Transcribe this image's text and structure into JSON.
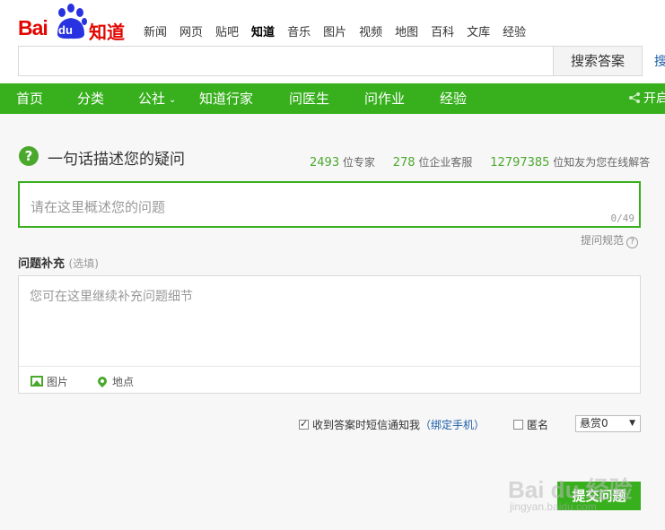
{
  "logo": {
    "bai": "Bai",
    "du": "du",
    "zhidao": "知道"
  },
  "topnav": [
    "新闻",
    "网页",
    "贴吧",
    "知道",
    "音乐",
    "图片",
    "视频",
    "地图",
    "百科",
    "文库",
    "经验"
  ],
  "topnav_active": "知道",
  "search": {
    "value": "",
    "button": "搜索答案",
    "extra": "搜"
  },
  "mainnav": {
    "items": [
      "首页",
      "分类",
      "公社",
      "知道行家",
      "问医生",
      "问作业",
      "经验"
    ],
    "share": "开启"
  },
  "question": {
    "title": "一句话描述您的疑问",
    "placeholder": "请在这里概述您的问题",
    "counter": "0/49",
    "rules_link": "提问规范",
    "rules_icon": "?"
  },
  "stats": {
    "experts_num": "2493",
    "experts_label": "位专家",
    "service_num": "278",
    "service_label": "位企业客服",
    "online_num": "12797385",
    "online_label": "位知友为您在线解答"
  },
  "supplement": {
    "label": "问题补充",
    "optional": "(选填)",
    "placeholder": "您可在这里继续补充问题细节",
    "image_tool": "图片",
    "location_tool": "地点"
  },
  "options": {
    "sms_notify": "收到答案时短信通知我",
    "bind_phone": "（绑定手机）",
    "anonymous": "匿名",
    "reward": "悬赏0"
  },
  "submit": "提交问题",
  "watermark": {
    "text": "Bai du 经验",
    "url": "jingyan.baidu.com"
  },
  "colors": {
    "brand_green": "#38b01e",
    "logo_red": "#e10601",
    "link_blue": "#1c5da8"
  }
}
